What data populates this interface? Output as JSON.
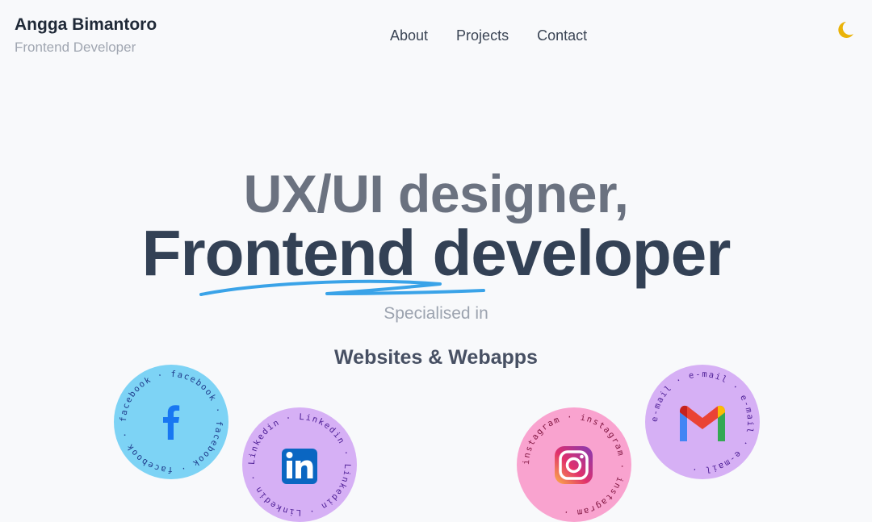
{
  "header": {
    "name": "Angga Bimantoro",
    "role": "Frontend Developer",
    "nav": [
      {
        "label": "About"
      },
      {
        "label": "Projects"
      },
      {
        "label": "Contact"
      }
    ],
    "theme_icon": "moon-icon"
  },
  "hero": {
    "line1": "UX/UI designer,",
    "line2": "Frontend developer",
    "subtitle": "Specialised in",
    "specialty": "Websites & Webapps"
  },
  "socials": [
    {
      "name": "facebook",
      "ring_text": "facebook · facebook · facebook · facebook · ",
      "icon": "facebook-icon",
      "color": "#7dd3f5"
    },
    {
      "name": "linkedin",
      "ring_text": "Linkedin · Linkedin · Linkedin · Linkedin · ",
      "icon": "linkedin-icon",
      "color": "#d6b0f5"
    },
    {
      "name": "instagram",
      "ring_text": "instagram · instagram · instagram · ",
      "icon": "instagram-icon",
      "color": "#f9a3cf"
    },
    {
      "name": "email",
      "ring_text": "e-mail · e-mail · e-mail · e-mail · ",
      "icon": "gmail-icon",
      "color": "#d6b0f5"
    }
  ],
  "colors": {
    "accent_blue": "#3aa3e8",
    "moon": "#eab308"
  }
}
